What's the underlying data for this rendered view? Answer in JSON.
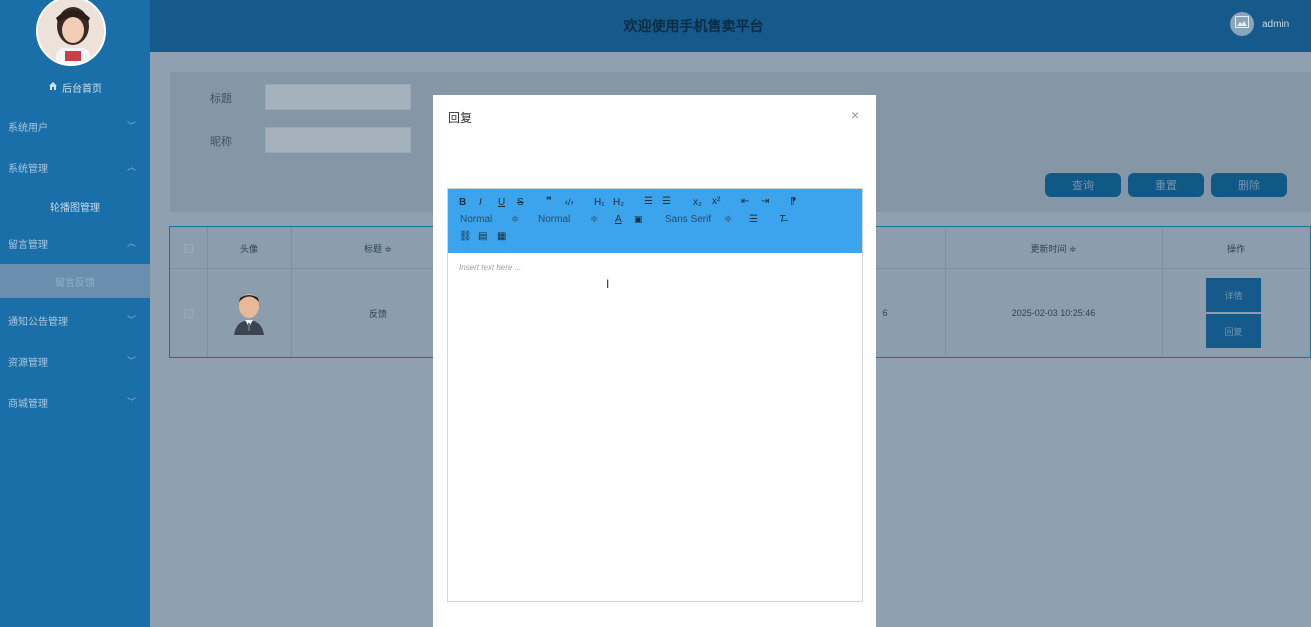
{
  "app": {
    "title": "欢迎使用手机售卖平台",
    "user": "admin"
  },
  "sidebar": {
    "home": "后台首页",
    "items": [
      {
        "label": "系统用户",
        "chevron": "﹀"
      },
      {
        "label": "系统管理",
        "chevron": "︿"
      },
      {
        "label": "轮播图管理",
        "sub": true
      },
      {
        "label": "留言管理",
        "chevron": "︿"
      },
      {
        "label": "留言反馈",
        "sub": true,
        "active": true
      },
      {
        "label": "通知公告管理",
        "chevron": "﹀"
      },
      {
        "label": "资源管理",
        "chevron": "﹀"
      },
      {
        "label": "商城管理",
        "chevron": "﹀"
      }
    ]
  },
  "search": {
    "title_label": "标题",
    "nickname_label": "昵称",
    "title_value": "",
    "nickname_value": "",
    "query_btn": "查询",
    "reset_btn": "重置",
    "delete_btn": "删除"
  },
  "table": {
    "headers": {
      "avatar": "头像",
      "title": "标题 ≑",
      "updated": "更新时间 ≑",
      "actions": "操作"
    },
    "row": {
      "title": "反馈",
      "partial": "6",
      "updated": "2025-02-03 10:25:46",
      "detail_btn": "详情",
      "reply_btn": "回复"
    }
  },
  "modal": {
    "title": "回复",
    "close": "×",
    "editor": {
      "placeholder": "Insert text here ...",
      "header_select": "Normal",
      "size_select": "Normal",
      "font_select": "Sans Serif"
    }
  },
  "colors": {
    "sidebar": "#1b6fa8",
    "header": "#155a8a",
    "toolbar": "#3ba4ed"
  }
}
